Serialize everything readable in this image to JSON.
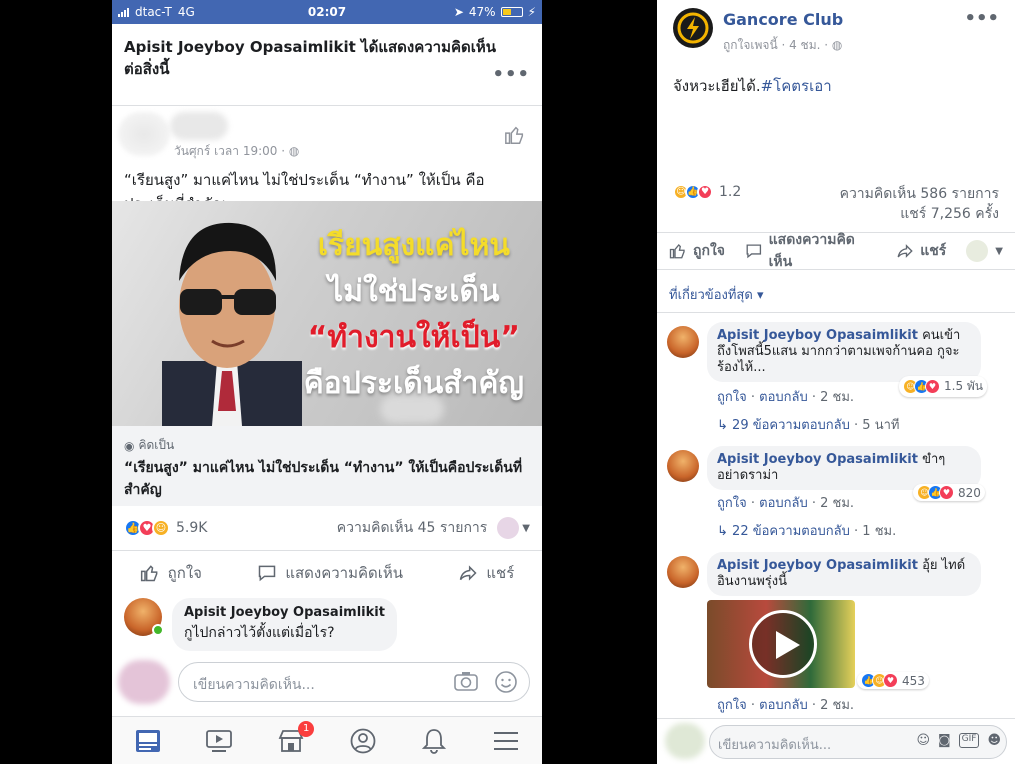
{
  "mobile": {
    "status": {
      "carrier": "dtac-T",
      "network": "4G",
      "time": "02:07",
      "battery": "47%",
      "battery_level": 0.47
    },
    "notice": "Apisit Joeyboy Opasaimlikit ได้แสดงความคิดเห็นต่อสิ่งนี้",
    "post": {
      "meta": "วันศุกร์ เวลา 19:00 ·",
      "text": "“เรียนสูง” มาแค่ไหน ไม่ใช่ประเด็น “ทำงาน” ให้เป็น คือประเด็นที่สำคัญ",
      "image_text": [
        "เรียนสูงแค่ไหน",
        "ไม่ใช่ประเด็น",
        "“ทำงานให้เป็น”",
        "คือประเด็นสำคัญ"
      ],
      "link_source": "คิดเป็น",
      "link_title": "“เรียนสูง” มาแค่ไหน ไม่ใช่ประเด็น “ทำงาน” ให้เป็นคือประเด็นที่สำคัญ",
      "reactions": "5.9K",
      "comments": "ความคิดเห็น 45 รายการ"
    },
    "actions": {
      "like": "ถูกใจ",
      "comment": "แสดงความคิดเห็น",
      "share": "แชร์"
    },
    "comment": {
      "name": "Apisit Joeyboy Opasaimlikit",
      "text": "กูไปกล่าวไว้ตั้งแต่เมื่อไร?"
    },
    "write_placeholder": "เขียนความคิดเห็น...",
    "tab_badge": "1"
  },
  "desktop": {
    "page_name": "Gancore Club",
    "page_meta": "ถูกใจเพจนี้ · 4 ชม. ·",
    "post_text": "จังหวะเฮียได้.",
    "hashtag": "#โคตรเอา",
    "reactions": "1.2",
    "comments": "ความคิดเห็น 586 รายการ",
    "shares": "แชร์ 7,256 ครั้ง",
    "actions": {
      "like": "ถูกใจ",
      "comment": "แสดงความคิดเห็น",
      "share": "แชร์"
    },
    "relevant": "ที่เกี่ยวข้องที่สุด",
    "comments_list": [
      {
        "name": "Apisit Joeyboy Opasaimlikit",
        "text": "คนเข้าถึงโพสนี้5แสน มากกว่าตามเพจก้านคอ กูจะร้องไห้...",
        "like": "ถูกใจ",
        "reply": "ตอบกลับ",
        "time": "2 ชม.",
        "reactions": "1.5 พัน",
        "replies": "29 ข้อความตอบกลับ",
        "replies_time": "5 นาที"
      },
      {
        "name": "Apisit Joeyboy Opasaimlikit",
        "text": "ขำๆ อย่าดราม่า",
        "like": "ถูกใจ",
        "reply": "ตอบกลับ",
        "time": "2 ชม.",
        "reactions": "820",
        "replies": "22 ข้อความตอบกลับ",
        "replies_time": "1 ชม."
      },
      {
        "name": "Apisit Joeyboy Opasaimlikit",
        "text": "อุ้ย ไทด์อินงานพรุ่งนี้",
        "like": "ถูกใจ",
        "reply": "ตอบกลับ",
        "time": "2 ชม.",
        "reactions": "453"
      }
    ],
    "write_placeholder": "เขียนความคิดเห็น...",
    "gif": "GIF"
  },
  "colors": {
    "fb_blue": "#4267b2",
    "link_blue": "#365899",
    "like_blue": "#1877f2",
    "love_red": "#f33e58",
    "haha_yellow": "#f7b125"
  }
}
